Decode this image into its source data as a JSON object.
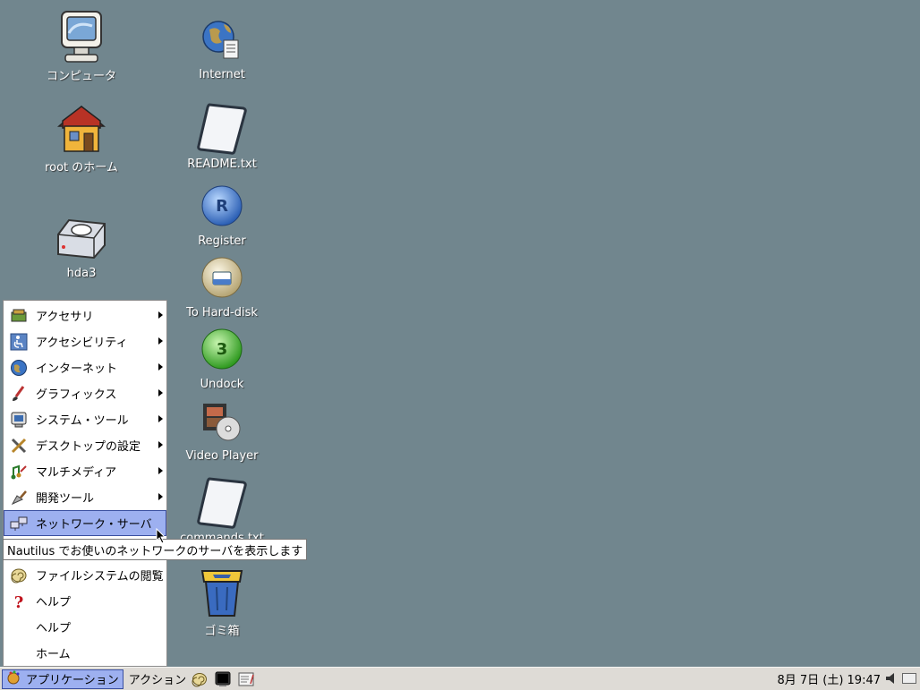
{
  "desktop": {
    "icons": {
      "computer": "コンピュータ",
      "home": "root のホーム",
      "hda3": "hda3",
      "internet": "Internet",
      "readme": "README.txt",
      "register": "Register",
      "hard_disk": "To Hard-disk",
      "undock": "Undock",
      "video_player": "Video Player",
      "commands": "commands.txt",
      "trash": "ゴミ箱"
    }
  },
  "menu": {
    "items": [
      {
        "label": "アクセサリ"
      },
      {
        "label": "アクセシビリティ"
      },
      {
        "label": "インターネット"
      },
      {
        "label": "グラフィックス"
      },
      {
        "label": "システム・ツール"
      },
      {
        "label": "デスクトップの設定"
      },
      {
        "label": "マルチメディア"
      },
      {
        "label": "開発ツール"
      },
      {
        "label": "ネットワーク・サーバ"
      },
      {
        "label": "ファイルシステムの閲覧"
      },
      {
        "label": "ヘルプ"
      },
      {
        "label": "ヘルプ"
      },
      {
        "label": "ホーム"
      }
    ]
  },
  "tooltip": "Nautilus でお使いのネットワークのサーバを表示します",
  "taskbar": {
    "applications": "アプリケーション",
    "actions": "アクション",
    "clock": "8月 7日 (土) 19:47"
  },
  "colors": {
    "desktop_bg": "#71868e",
    "selection": "#9db0f0",
    "taskbar": "#dedbd6"
  }
}
